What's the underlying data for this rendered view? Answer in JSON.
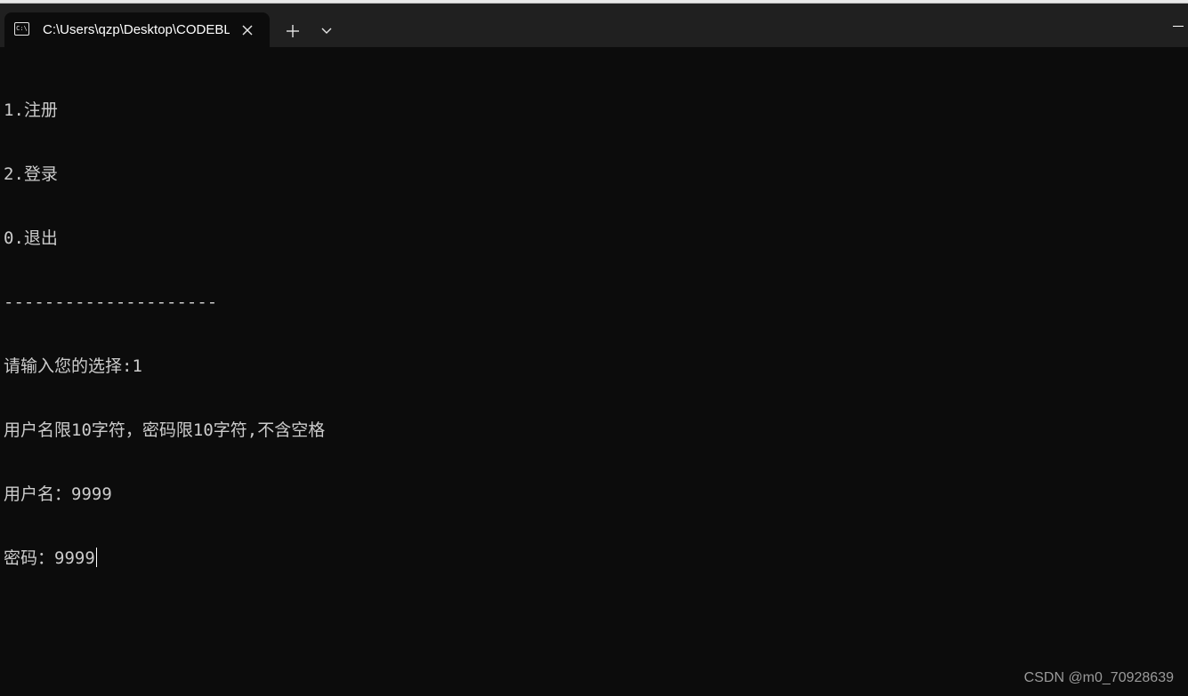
{
  "tab": {
    "title": "C:\\Users\\qzp\\Desktop\\CODEBLOCKS\\main.exe",
    "icon": "terminal-icon",
    "close_icon": "close-icon"
  },
  "tabbar": {
    "new_tab_icon": "plus-icon",
    "dropdown_icon": "chevron-down-icon",
    "minimize_icon": "minimize-icon"
  },
  "terminal": {
    "lines": [
      "1.注册",
      "2.登录",
      "0.退出",
      "---------------------",
      "请输入您的选择:1",
      "用户名限10字符，密码限10字符,不含空格",
      "用户名：9999",
      "密码：9999"
    ]
  },
  "watermark": "CSDN @m0_70928639",
  "colors": {
    "background": "#0c0c0c",
    "tabbar": "#202020",
    "text": "#cccccc"
  }
}
